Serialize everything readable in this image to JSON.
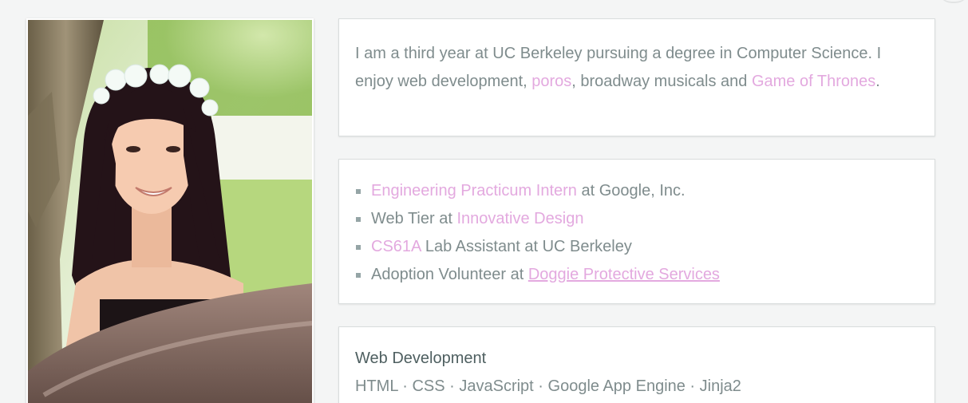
{
  "bio": {
    "text_1": "I am a third year at UC Berkeley pursuing a degree in Computer Science. I enjoy web development, ",
    "link_poros": "poros",
    "text_2": ", broadway musicals and ",
    "link_got": "Game of Thrones",
    "text_3": "."
  },
  "experience": {
    "items": [
      {
        "link": "Engineering Practicum Intern",
        "after": " at Google, Inc."
      },
      {
        "before": "Web Tier at ",
        "link": "Innovative Design"
      },
      {
        "link": "CS61A",
        "after": " Lab Assistant at UC Berkeley"
      },
      {
        "before": "Adoption Volunteer at ",
        "link": "Doggie Protective Services"
      }
    ]
  },
  "skills": {
    "title": "Web Development",
    "list": "HTML · CSS · JavaScript · Google App Engine · Jinja2"
  },
  "colors": {
    "link": "#e3a9df",
    "text": "#7f8c8d",
    "heading": "#4e5f60",
    "background": "#f4f5f5"
  }
}
